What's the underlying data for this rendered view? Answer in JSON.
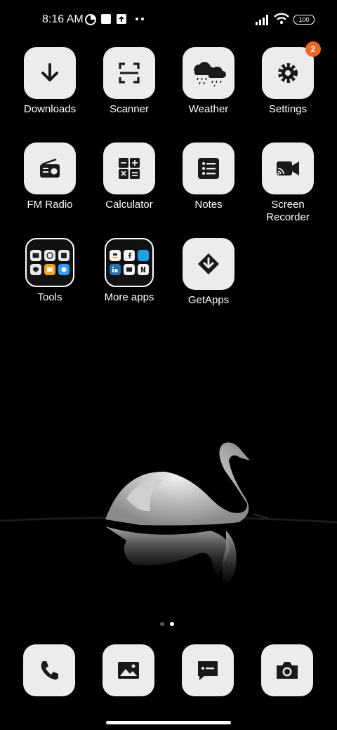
{
  "status": {
    "time": "8:16 AM",
    "battery": "100"
  },
  "apps": [
    {
      "label": "Downloads",
      "icon": "download-arrow-icon"
    },
    {
      "label": "Scanner",
      "icon": "scan-frame-icon"
    },
    {
      "label": "Weather",
      "icon": "rain-cloud-icon"
    },
    {
      "label": "Settings",
      "icon": "gear-icon",
      "badge": "2"
    },
    {
      "label": "FM Radio",
      "icon": "radio-icon"
    },
    {
      "label": "Calculator",
      "icon": "calculator-icon"
    },
    {
      "label": "Notes",
      "icon": "notes-list-icon"
    },
    {
      "label": "Screen Recorder",
      "label_line1": "Screen",
      "label_line2": "Recorder",
      "icon": "video-camera-icon"
    },
    {
      "label": "Tools",
      "icon": "folder-icon"
    },
    {
      "label": "More apps",
      "icon": "folder-icon"
    },
    {
      "label": "GetApps",
      "icon": "getapps-icon"
    }
  ],
  "dock": [
    {
      "icon": "phone-icon"
    },
    {
      "icon": "gallery-icon"
    },
    {
      "icon": "message-icon"
    },
    {
      "icon": "camera-icon"
    }
  ],
  "pager": {
    "pages": 2,
    "current": 2
  },
  "colors": {
    "tile": "#ececec",
    "badge": "#f26522",
    "background": "#000000"
  }
}
